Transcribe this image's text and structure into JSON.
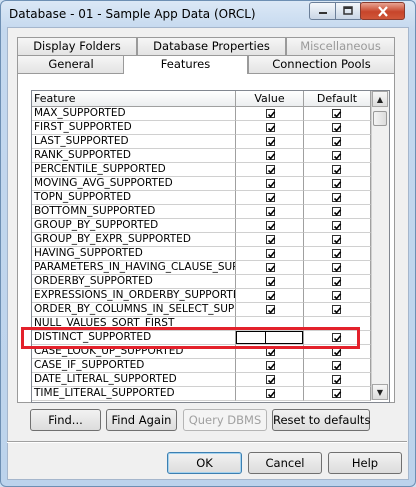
{
  "window": {
    "title": "Database - 01 - Sample App Data (ORCL)"
  },
  "tabs_row1": [
    {
      "label": "Display Folders"
    },
    {
      "label": "Database Properties"
    },
    {
      "label": "Miscellaneous"
    }
  ],
  "tabs_row2": [
    {
      "label": "General"
    },
    {
      "label": "Features"
    },
    {
      "label": "Connection Pools"
    }
  ],
  "grid": {
    "headers": {
      "feature": "Feature",
      "value": "Value",
      "default": "Default"
    },
    "rows": [
      {
        "feature": "MAX_SUPPORTED",
        "value": true,
        "default": true
      },
      {
        "feature": "FIRST_SUPPORTED",
        "value": true,
        "default": true
      },
      {
        "feature": "LAST_SUPPORTED",
        "value": true,
        "default": true
      },
      {
        "feature": "RANK_SUPPORTED",
        "value": true,
        "default": true
      },
      {
        "feature": "PERCENTILE_SUPPORTED",
        "value": true,
        "default": true
      },
      {
        "feature": "MOVING_AVG_SUPPORTED",
        "value": true,
        "default": true
      },
      {
        "feature": "TOPN_SUPPORTED",
        "value": true,
        "default": true
      },
      {
        "feature": "BOTTOMN_SUPPORTED",
        "value": true,
        "default": true
      },
      {
        "feature": "GROUP_BY_SUPPORTED",
        "value": true,
        "default": true
      },
      {
        "feature": "GROUP_BY_EXPR_SUPPORTED",
        "value": true,
        "default": true
      },
      {
        "feature": "HAVING_SUPPORTED",
        "value": true,
        "default": true
      },
      {
        "feature": "PARAMETERS_IN_HAVING_CLAUSE_SUP",
        "value": true,
        "default": true
      },
      {
        "feature": "ORDERBY_SUPPORTED",
        "value": true,
        "default": true
      },
      {
        "feature": "EXPRESSIONS_IN_ORDERBY_SUPPORTE",
        "value": true,
        "default": true
      },
      {
        "feature": "ORDER_BY_COLUMNS_IN_SELECT_SUPP",
        "value": true,
        "default": true
      },
      {
        "feature": "NULL_VALUES_SORT_FIRST",
        "value": false,
        "default": false
      },
      {
        "feature": "DISTINCT_SUPPORTED",
        "value": false,
        "default": true,
        "editing": true
      },
      {
        "feature": "CASE_LOOK_UP_SUPPORTED",
        "value": true,
        "default": true
      },
      {
        "feature": "CASE_IF_SUPPORTED",
        "value": true,
        "default": true
      },
      {
        "feature": "DATE_LITERAL_SUPPORTED",
        "value": true,
        "default": true
      },
      {
        "feature": "TIME_LITERAL_SUPPORTED",
        "value": true,
        "default": true
      }
    ]
  },
  "actions": {
    "find": "Find...",
    "find_again": "Find Again",
    "query_dbms": "Query DBMS",
    "reset": "Reset to defaults"
  },
  "footer": {
    "ok": "OK",
    "cancel": "Cancel",
    "help": "Help"
  }
}
